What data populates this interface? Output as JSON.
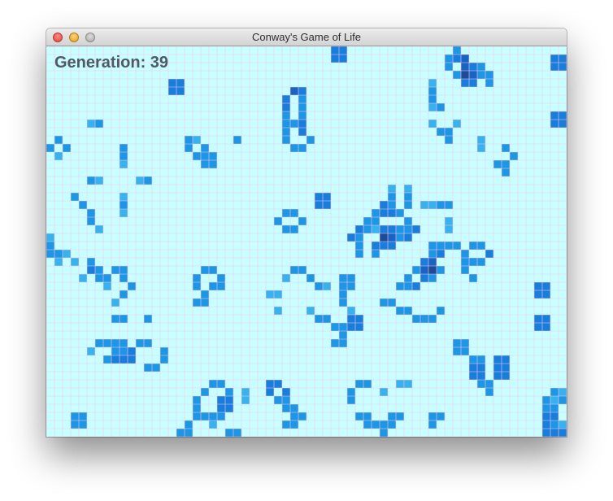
{
  "window": {
    "title": "Conway's Game of Life",
    "controls": [
      "close",
      "minimize",
      "zoom"
    ]
  },
  "status": {
    "generation_label": "Generation: 39"
  },
  "colors": {
    "board_background": "#c8ffff",
    "grid_line": "#f0c8f0",
    "cell_levels": [
      "#b4f0ff",
      "#7dd2f5",
      "#38b2ee",
      "#1e96e6",
      "#197ddc",
      "#1964c3",
      "#1e4b96"
    ]
  },
  "board": {
    "cols": 64,
    "rows": 48,
    "alive_cells": [
      [
        35,
        0,
        4
      ],
      [
        36,
        0,
        4
      ],
      [
        62,
        1,
        4
      ],
      [
        63,
        1,
        4
      ],
      [
        62,
        2,
        4
      ],
      [
        63,
        2,
        4
      ],
      [
        35,
        1,
        4
      ],
      [
        36,
        1,
        4
      ],
      [
        50,
        0,
        3
      ],
      [
        49,
        1,
        3
      ],
      [
        50,
        1,
        4
      ],
      [
        51,
        1,
        5
      ],
      [
        49,
        2,
        3
      ],
      [
        51,
        2,
        5
      ],
      [
        52,
        2,
        4
      ],
      [
        53,
        2,
        3
      ],
      [
        50,
        3,
        3
      ],
      [
        51,
        3,
        6
      ],
      [
        52,
        3,
        5
      ],
      [
        53,
        3,
        3
      ],
      [
        51,
        4,
        4
      ],
      [
        52,
        4,
        4
      ],
      [
        54,
        3,
        3
      ],
      [
        54,
        4,
        3
      ],
      [
        15,
        4,
        4
      ],
      [
        16,
        4,
        4
      ],
      [
        15,
        5,
        4
      ],
      [
        16,
        5,
        4
      ],
      [
        47,
        4,
        2
      ],
      [
        47,
        5,
        3
      ],
      [
        47,
        6,
        3
      ],
      [
        47,
        7,
        2
      ],
      [
        48,
        7,
        3
      ],
      [
        30,
        5,
        5
      ],
      [
        31,
        5,
        4
      ],
      [
        29,
        6,
        4
      ],
      [
        31,
        6,
        3
      ],
      [
        29,
        7,
        4
      ],
      [
        31,
        7,
        3
      ],
      [
        29,
        8,
        3
      ],
      [
        31,
        8,
        3
      ],
      [
        29,
        9,
        3
      ],
      [
        30,
        9,
        3
      ],
      [
        31,
        9,
        4
      ],
      [
        29,
        10,
        3
      ],
      [
        31,
        10,
        4
      ],
      [
        29,
        11,
        3
      ],
      [
        32,
        11,
        3
      ],
      [
        30,
        12,
        3
      ],
      [
        31,
        12,
        3
      ],
      [
        5,
        9,
        2
      ],
      [
        6,
        9,
        3
      ],
      [
        47,
        9,
        2
      ],
      [
        50,
        9,
        2
      ],
      [
        48,
        10,
        3
      ],
      [
        49,
        10,
        3
      ],
      [
        49,
        11,
        3
      ],
      [
        62,
        8,
        4
      ],
      [
        63,
        8,
        4
      ],
      [
        62,
        9,
        4
      ],
      [
        63,
        9,
        4
      ],
      [
        1,
        11,
        3
      ],
      [
        0,
        12,
        3
      ],
      [
        2,
        12,
        3
      ],
      [
        1,
        13,
        2
      ],
      [
        17,
        11,
        3
      ],
      [
        18,
        11,
        2
      ],
      [
        23,
        11,
        3
      ],
      [
        17,
        12,
        3
      ],
      [
        19,
        12,
        3
      ],
      [
        20,
        13,
        3
      ],
      [
        18,
        13,
        3
      ],
      [
        19,
        13,
        3
      ],
      [
        19,
        14,
        3
      ],
      [
        20,
        14,
        3
      ],
      [
        9,
        12,
        3
      ],
      [
        9,
        13,
        3
      ],
      [
        9,
        14,
        2
      ],
      [
        53,
        11,
        2
      ],
      [
        53,
        12,
        2
      ],
      [
        56,
        12,
        3
      ],
      [
        57,
        13,
        3
      ],
      [
        56,
        14,
        3
      ],
      [
        55,
        14,
        3
      ],
      [
        56,
        15,
        3
      ],
      [
        5,
        16,
        3
      ],
      [
        6,
        16,
        2
      ],
      [
        11,
        16,
        2
      ],
      [
        12,
        16,
        3
      ],
      [
        42,
        17,
        2
      ],
      [
        44,
        17,
        2
      ],
      [
        42,
        18,
        3
      ],
      [
        44,
        18,
        3
      ],
      [
        41,
        19,
        4
      ],
      [
        42,
        19,
        3
      ],
      [
        44,
        19,
        3
      ],
      [
        40,
        20,
        3
      ],
      [
        41,
        20,
        4
      ],
      [
        42,
        20,
        4
      ],
      [
        43,
        20,
        3
      ],
      [
        39,
        21,
        3
      ],
      [
        40,
        21,
        3
      ],
      [
        44,
        21,
        3
      ],
      [
        38,
        22,
        4
      ],
      [
        39,
        22,
        3
      ],
      [
        40,
        22,
        2
      ],
      [
        41,
        22,
        4
      ],
      [
        42,
        22,
        4
      ],
      [
        43,
        22,
        3
      ],
      [
        44,
        22,
        3
      ],
      [
        45,
        22,
        4
      ],
      [
        37,
        23,
        4
      ],
      [
        38,
        23,
        3
      ],
      [
        41,
        23,
        6
      ],
      [
        42,
        23,
        5
      ],
      [
        43,
        23,
        3
      ],
      [
        44,
        23,
        4
      ],
      [
        38,
        24,
        3
      ],
      [
        40,
        24,
        4
      ],
      [
        41,
        24,
        4
      ],
      [
        42,
        24,
        4
      ],
      [
        40,
        25,
        3
      ],
      [
        38,
        25,
        3
      ],
      [
        33,
        18,
        4
      ],
      [
        34,
        18,
        4
      ],
      [
        33,
        19,
        4
      ],
      [
        34,
        19,
        4
      ],
      [
        3,
        18,
        3
      ],
      [
        4,
        19,
        3
      ],
      [
        5,
        20,
        3
      ],
      [
        5,
        21,
        3
      ],
      [
        6,
        22,
        2
      ],
      [
        9,
        18,
        2
      ],
      [
        9,
        19,
        3
      ],
      [
        9,
        20,
        2
      ],
      [
        46,
        19,
        2
      ],
      [
        47,
        19,
        2
      ],
      [
        48,
        19,
        3
      ],
      [
        49,
        19,
        3
      ],
      [
        29,
        20,
        3
      ],
      [
        30,
        20,
        3
      ],
      [
        28,
        21,
        3
      ],
      [
        31,
        21,
        3
      ],
      [
        29,
        22,
        3
      ],
      [
        30,
        22,
        3
      ],
      [
        49,
        21,
        2
      ],
      [
        49,
        22,
        2
      ],
      [
        0,
        23,
        2
      ],
      [
        0,
        24,
        3
      ],
      [
        0,
        25,
        3
      ],
      [
        1,
        26,
        2
      ],
      [
        1,
        25,
        3
      ],
      [
        2,
        25,
        2
      ],
      [
        3,
        26,
        2
      ],
      [
        5,
        26,
        3
      ],
      [
        5,
        27,
        4
      ],
      [
        6,
        27,
        3
      ],
      [
        6,
        28,
        3
      ],
      [
        7,
        28,
        3
      ],
      [
        7,
        29,
        2
      ],
      [
        4,
        28,
        2
      ],
      [
        8,
        27,
        3
      ],
      [
        9,
        27,
        3
      ],
      [
        9,
        28,
        3
      ],
      [
        10,
        29,
        3
      ],
      [
        9,
        30,
        3
      ],
      [
        8,
        31,
        2
      ],
      [
        47,
        24,
        3
      ],
      [
        48,
        24,
        3
      ],
      [
        49,
        24,
        3
      ],
      [
        50,
        24,
        3
      ],
      [
        47,
        25,
        3
      ],
      [
        48,
        25,
        4
      ],
      [
        52,
        24,
        3
      ],
      [
        53,
        24,
        3
      ],
      [
        51,
        25,
        3
      ],
      [
        54,
        25,
        4
      ],
      [
        51,
        26,
        3
      ],
      [
        52,
        26,
        3
      ],
      [
        53,
        26,
        3
      ],
      [
        46,
        26,
        4
      ],
      [
        47,
        26,
        5
      ],
      [
        47,
        27,
        6
      ],
      [
        46,
        27,
        5
      ],
      [
        45,
        27,
        3
      ],
      [
        44,
        28,
        3
      ],
      [
        46,
        28,
        4
      ],
      [
        43,
        29,
        3
      ],
      [
        44,
        29,
        3
      ],
      [
        45,
        29,
        4
      ],
      [
        48,
        27,
        3
      ],
      [
        47,
        28,
        3
      ],
      [
        51,
        27,
        3
      ],
      [
        52,
        28,
        3
      ],
      [
        19,
        27,
        3
      ],
      [
        20,
        27,
        3
      ],
      [
        18,
        28,
        3
      ],
      [
        21,
        28,
        3
      ],
      [
        18,
        29,
        3
      ],
      [
        20,
        29,
        3
      ],
      [
        19,
        30,
        3
      ],
      [
        18,
        31,
        3
      ],
      [
        19,
        31,
        3
      ],
      [
        21,
        29,
        3
      ],
      [
        30,
        27,
        3
      ],
      [
        31,
        27,
        3
      ],
      [
        29,
        28,
        2
      ],
      [
        32,
        28,
        3
      ],
      [
        33,
        29,
        3
      ],
      [
        34,
        29,
        2
      ],
      [
        36,
        28,
        3
      ],
      [
        37,
        28,
        3
      ],
      [
        36,
        29,
        3
      ],
      [
        37,
        29,
        3
      ],
      [
        36,
        30,
        3
      ],
      [
        36,
        31,
        3
      ],
      [
        37,
        32,
        2
      ],
      [
        60,
        29,
        4
      ],
      [
        61,
        29,
        4
      ],
      [
        60,
        30,
        4
      ],
      [
        61,
        30,
        4
      ],
      [
        27,
        30,
        2
      ],
      [
        28,
        30,
        2
      ],
      [
        28,
        32,
        2
      ],
      [
        41,
        31,
        3
      ],
      [
        42,
        31,
        3
      ],
      [
        43,
        32,
        3
      ],
      [
        44,
        32,
        3
      ],
      [
        45,
        33,
        3
      ],
      [
        46,
        33,
        3
      ],
      [
        47,
        33,
        3
      ],
      [
        48,
        32,
        3
      ],
      [
        32,
        32,
        2
      ],
      [
        33,
        33,
        3
      ],
      [
        34,
        33,
        3
      ],
      [
        35,
        34,
        3
      ],
      [
        36,
        34,
        3
      ],
      [
        37,
        33,
        4
      ],
      [
        38,
        33,
        4
      ],
      [
        37,
        34,
        4
      ],
      [
        38,
        34,
        4
      ],
      [
        36,
        35,
        3
      ],
      [
        35,
        36,
        3
      ],
      [
        36,
        36,
        3
      ],
      [
        60,
        33,
        4
      ],
      [
        61,
        33,
        4
      ],
      [
        60,
        34,
        4
      ],
      [
        61,
        34,
        4
      ],
      [
        8,
        33,
        3
      ],
      [
        9,
        33,
        3
      ],
      [
        12,
        33,
        3
      ],
      [
        6,
        36,
        3
      ],
      [
        7,
        36,
        3
      ],
      [
        8,
        36,
        3
      ],
      [
        9,
        36,
        3
      ],
      [
        11,
        36,
        3
      ],
      [
        12,
        36,
        3
      ],
      [
        5,
        37,
        2
      ],
      [
        8,
        37,
        3
      ],
      [
        9,
        37,
        3
      ],
      [
        10,
        37,
        4
      ],
      [
        14,
        37,
        3
      ],
      [
        7,
        38,
        3
      ],
      [
        8,
        38,
        4
      ],
      [
        9,
        38,
        4
      ],
      [
        10,
        38,
        4
      ],
      [
        14,
        38,
        3
      ],
      [
        12,
        39,
        3
      ],
      [
        13,
        39,
        3
      ],
      [
        50,
        36,
        3
      ],
      [
        51,
        36,
        3
      ],
      [
        51,
        37,
        3
      ],
      [
        52,
        38,
        3
      ],
      [
        53,
        38,
        3
      ],
      [
        52,
        39,
        4
      ],
      [
        53,
        39,
        4
      ],
      [
        52,
        40,
        4
      ],
      [
        53,
        40,
        4
      ],
      [
        54,
        41,
        3
      ],
      [
        55,
        40,
        4
      ],
      [
        56,
        40,
        4
      ],
      [
        55,
        39,
        4
      ],
      [
        56,
        39,
        4
      ],
      [
        55,
        38,
        4
      ],
      [
        56,
        38,
        4
      ],
      [
        54,
        42,
        3
      ],
      [
        50,
        37,
        3
      ],
      [
        53,
        41,
        3
      ],
      [
        20,
        41,
        3
      ],
      [
        21,
        41,
        3
      ],
      [
        19,
        42,
        3
      ],
      [
        22,
        42,
        3
      ],
      [
        18,
        43,
        3
      ],
      [
        21,
        43,
        4
      ],
      [
        22,
        43,
        4
      ],
      [
        18,
        44,
        3
      ],
      [
        21,
        44,
        4
      ],
      [
        22,
        44,
        4
      ],
      [
        24,
        42,
        2
      ],
      [
        24,
        43,
        2
      ],
      [
        27,
        41,
        4
      ],
      [
        28,
        41,
        4
      ],
      [
        27,
        42,
        4
      ],
      [
        29,
        42,
        4
      ],
      [
        28,
        43,
        3
      ],
      [
        29,
        43,
        3
      ],
      [
        29,
        44,
        3
      ],
      [
        30,
        44,
        3
      ],
      [
        30,
        45,
        3
      ],
      [
        31,
        45,
        3
      ],
      [
        29,
        46,
        3
      ],
      [
        30,
        46,
        3
      ],
      [
        38,
        41,
        3
      ],
      [
        39,
        41,
        3
      ],
      [
        37,
        42,
        3
      ],
      [
        41,
        42,
        2
      ],
      [
        37,
        43,
        3
      ],
      [
        43,
        41,
        2
      ],
      [
        44,
        41,
        2
      ],
      [
        38,
        45,
        3
      ],
      [
        39,
        45,
        3
      ],
      [
        42,
        45,
        3
      ],
      [
        43,
        45,
        3
      ],
      [
        39,
        46,
        3
      ],
      [
        40,
        46,
        3
      ],
      [
        41,
        46,
        3
      ],
      [
        42,
        46,
        3
      ],
      [
        41,
        47,
        3
      ],
      [
        47,
        45,
        3
      ],
      [
        48,
        45,
        3
      ],
      [
        47,
        46,
        3
      ],
      [
        3,
        45,
        3
      ],
      [
        4,
        45,
        3
      ],
      [
        3,
        46,
        3
      ],
      [
        4,
        46,
        3
      ],
      [
        18,
        45,
        3
      ],
      [
        19,
        45,
        3
      ],
      [
        20,
        45,
        3
      ],
      [
        21,
        45,
        3
      ],
      [
        17,
        46,
        3
      ],
      [
        20,
        46,
        2
      ],
      [
        16,
        47,
        3
      ],
      [
        17,
        47,
        3
      ],
      [
        22,
        47,
        3
      ],
      [
        23,
        47,
        3
      ],
      [
        62,
        42,
        3
      ],
      [
        63,
        42,
        2
      ],
      [
        61,
        43,
        3
      ],
      [
        62,
        43,
        2
      ],
      [
        63,
        43,
        3
      ],
      [
        61,
        44,
        3
      ],
      [
        62,
        44,
        3
      ],
      [
        61,
        45,
        4
      ],
      [
        62,
        45,
        4
      ],
      [
        61,
        46,
        4
      ],
      [
        62,
        46,
        3
      ],
      [
        61,
        47,
        4
      ],
      [
        62,
        47,
        4
      ],
      [
        63,
        47,
        4
      ],
      [
        63,
        46,
        2
      ]
    ]
  }
}
